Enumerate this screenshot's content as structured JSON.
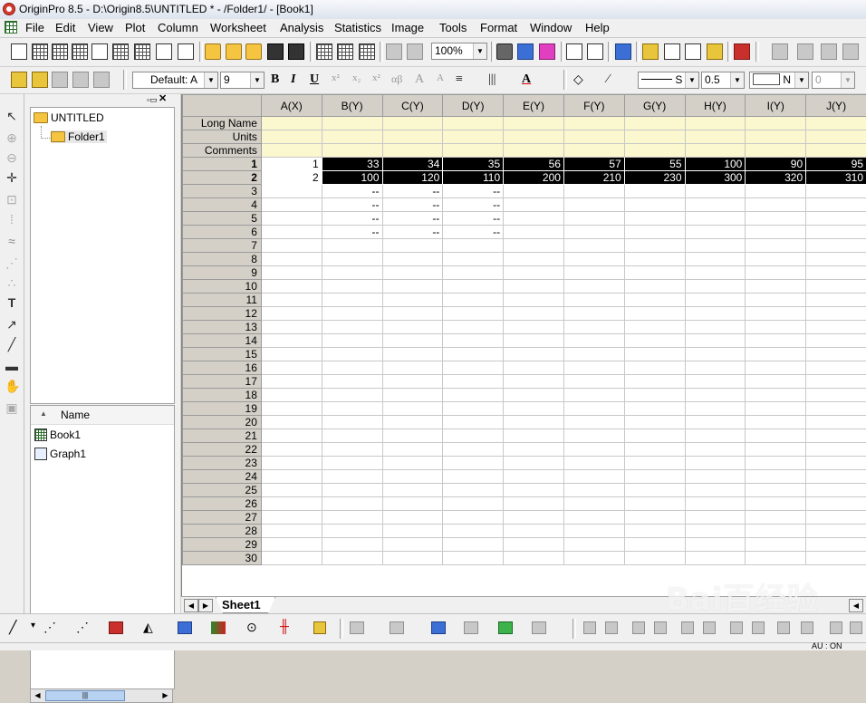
{
  "window": {
    "title": "OriginPro 8.5 - D:\\Origin8.5\\UNTITLED * - /Folder1/ - [Book1]"
  },
  "menu": [
    "File",
    "Edit",
    "View",
    "Plot",
    "Column",
    "Worksheet",
    "Analysis",
    "Statistics",
    "Image",
    "Tools",
    "Format",
    "Window",
    "Help"
  ],
  "toolbar": {
    "zoom_value": "100%",
    "font_value": "Default: A",
    "font_size": "9",
    "line_width": "0.5",
    "line_style_label": "S",
    "fill_label": "N",
    "num_value": "0"
  },
  "explorer": {
    "root": "UNTITLED",
    "folder": "Folder1",
    "list_header": "Name",
    "items": [
      "Book1",
      "Graph1"
    ]
  },
  "worksheet": {
    "columns": [
      "A(X)",
      "B(Y)",
      "C(Y)",
      "D(Y)",
      "E(Y)",
      "F(Y)",
      "G(Y)",
      "H(Y)",
      "I(Y)",
      "J(Y)"
    ],
    "meta_rows": [
      "Long Name",
      "Units",
      "Comments"
    ],
    "data_rows": [
      [
        "1",
        "1",
        "33",
        "34",
        "35",
        "56",
        "57",
        "55",
        "100",
        "90",
        "95"
      ],
      [
        "2",
        "2",
        "100",
        "120",
        "110",
        "200",
        "210",
        "230",
        "300",
        "320",
        "310"
      ],
      [
        "3",
        "",
        "--",
        "--",
        "--",
        "",
        "",
        "",
        "",
        "",
        ""
      ],
      [
        "4",
        "",
        "--",
        "--",
        "--",
        "",
        "",
        "",
        "",
        "",
        ""
      ],
      [
        "5",
        "",
        "--",
        "--",
        "--",
        "",
        "",
        "",
        "",
        "",
        ""
      ],
      [
        "6",
        "",
        "--",
        "--",
        "--",
        "",
        "",
        "",
        "",
        "",
        ""
      ],
      [
        "7",
        "",
        "",
        "",
        "",
        "",
        "",
        "",
        "",
        "",
        ""
      ],
      [
        "8",
        "",
        "",
        "",
        "",
        "",
        "",
        "",
        "",
        "",
        ""
      ],
      [
        "9",
        "",
        "",
        "",
        "",
        "",
        "",
        "",
        "",
        "",
        ""
      ],
      [
        "10",
        "",
        "",
        "",
        "",
        "",
        "",
        "",
        "",
        "",
        ""
      ],
      [
        "11",
        "",
        "",
        "",
        "",
        "",
        "",
        "",
        "",
        "",
        ""
      ],
      [
        "12",
        "",
        "",
        "",
        "",
        "",
        "",
        "",
        "",
        "",
        ""
      ],
      [
        "13",
        "",
        "",
        "",
        "",
        "",
        "",
        "",
        "",
        "",
        ""
      ],
      [
        "14",
        "",
        "",
        "",
        "",
        "",
        "",
        "",
        "",
        "",
        ""
      ],
      [
        "15",
        "",
        "",
        "",
        "",
        "",
        "",
        "",
        "",
        "",
        ""
      ],
      [
        "16",
        "",
        "",
        "",
        "",
        "",
        "",
        "",
        "",
        "",
        ""
      ],
      [
        "17",
        "",
        "",
        "",
        "",
        "",
        "",
        "",
        "",
        "",
        ""
      ],
      [
        "18",
        "",
        "",
        "",
        "",
        "",
        "",
        "",
        "",
        "",
        ""
      ],
      [
        "19",
        "",
        "",
        "",
        "",
        "",
        "",
        "",
        "",
        "",
        ""
      ],
      [
        "20",
        "",
        "",
        "",
        "",
        "",
        "",
        "",
        "",
        "",
        ""
      ],
      [
        "21",
        "",
        "",
        "",
        "",
        "",
        "",
        "",
        "",
        "",
        ""
      ],
      [
        "22",
        "",
        "",
        "",
        "",
        "",
        "",
        "",
        "",
        "",
        ""
      ],
      [
        "23",
        "",
        "",
        "",
        "",
        "",
        "",
        "",
        "",
        "",
        ""
      ],
      [
        "24",
        "",
        "",
        "",
        "",
        "",
        "",
        "",
        "",
        "",
        ""
      ],
      [
        "25",
        "",
        "",
        "",
        "",
        "",
        "",
        "",
        "",
        "",
        ""
      ],
      [
        "26",
        "",
        "",
        "",
        "",
        "",
        "",
        "",
        "",
        "",
        ""
      ],
      [
        "27",
        "",
        "",
        "",
        "",
        "",
        "",
        "",
        "",
        "",
        ""
      ],
      [
        "28",
        "",
        "",
        "",
        "",
        "",
        "",
        "",
        "",
        "",
        ""
      ],
      [
        "29",
        "",
        "",
        "",
        "",
        "",
        "",
        "",
        "",
        "",
        ""
      ],
      [
        "30",
        "",
        "",
        "",
        "",
        "",
        "",
        "",
        "",
        "",
        ""
      ]
    ],
    "selected_rows": [
      1,
      2
    ],
    "sheet_tab": "Sheet1"
  },
  "status": {
    "text": "AU : ON"
  },
  "watermark": "Bai百经验"
}
